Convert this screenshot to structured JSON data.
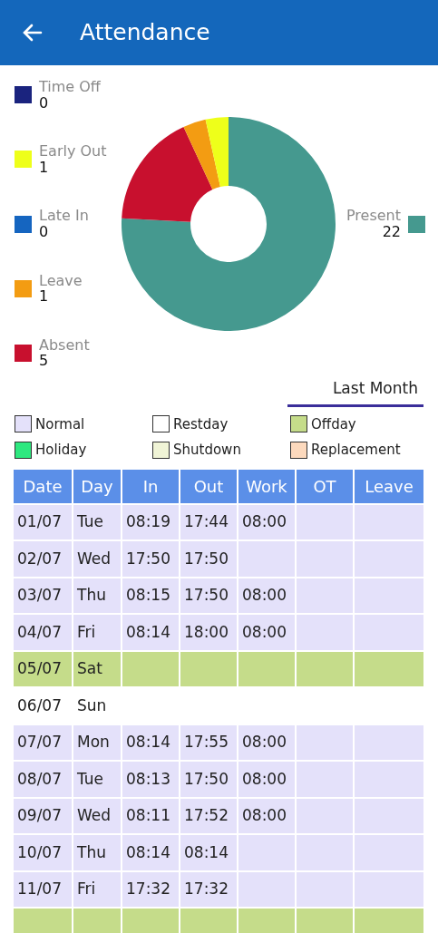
{
  "header": {
    "title": "Attendance"
  },
  "summary": {
    "left_legend": [
      {
        "label": "Time Off",
        "value": "0",
        "color": "#1a237e"
      },
      {
        "label": "Early Out",
        "value": "1",
        "color": "#eeff1a"
      },
      {
        "label": "Late In",
        "value": "0",
        "color": "#1565c0"
      },
      {
        "label": "Leave",
        "value": "1",
        "color": "#f39c12"
      },
      {
        "label": "Absent",
        "value": "5",
        "color": "#c8102e"
      }
    ],
    "right_legend": [
      {
        "label": "Present",
        "value": "22",
        "color": "#45998f"
      }
    ],
    "chart_data": {
      "type": "donut",
      "values": [
        0,
        3.45,
        0,
        3.45,
        17.24,
        75.86
      ]
    }
  },
  "period_tab": {
    "label": "Last Month",
    "selected": true
  },
  "day_types": [
    {
      "kind": "normal",
      "label": "Normal",
      "color": "#e4e1fa"
    },
    {
      "kind": "restday",
      "label": "Restday",
      "color": "#ffffff"
    },
    {
      "kind": "offday",
      "label": "Offday",
      "color": "#c5dc8a"
    },
    {
      "kind": "holiday",
      "label": "Holiday",
      "color": "#2ee87f"
    },
    {
      "kind": "shutdown",
      "label": "Shutdown",
      "color": "#f0f4d6"
    },
    {
      "kind": "replacement",
      "label": "Replacement",
      "color": "#fcd9bd"
    }
  ],
  "table": {
    "columns": [
      "Date",
      "Day",
      "In",
      "Out",
      "Work",
      "OT",
      "Leave"
    ],
    "rows": [
      {
        "kind": "normal",
        "cells": [
          "01/07",
          "Tue",
          "08:19",
          "17:44",
          "08:00",
          "",
          ""
        ]
      },
      {
        "kind": "normal",
        "cells": [
          "02/07",
          "Wed",
          "17:50",
          "17:50",
          "",
          "",
          ""
        ]
      },
      {
        "kind": "normal",
        "cells": [
          "03/07",
          "Thu",
          "08:15",
          "17:50",
          "08:00",
          "",
          ""
        ]
      },
      {
        "kind": "normal",
        "cells": [
          "04/07",
          "Fri",
          "08:14",
          "18:00",
          "08:00",
          "",
          ""
        ]
      },
      {
        "kind": "offday",
        "cells": [
          "05/07",
          "Sat",
          "",
          "",
          "",
          "",
          ""
        ]
      },
      {
        "kind": "restday",
        "cells": [
          "06/07",
          "Sun",
          "",
          "",
          "",
          "",
          ""
        ]
      },
      {
        "kind": "normal",
        "cells": [
          "07/07",
          "Mon",
          "08:14",
          "17:55",
          "08:00",
          "",
          ""
        ]
      },
      {
        "kind": "normal",
        "cells": [
          "08/07",
          "Tue",
          "08:13",
          "17:50",
          "08:00",
          "",
          ""
        ]
      },
      {
        "kind": "normal",
        "cells": [
          "09/07",
          "Wed",
          "08:11",
          "17:52",
          "08:00",
          "",
          ""
        ]
      },
      {
        "kind": "normal",
        "cells": [
          "10/07",
          "Thu",
          "08:14",
          "08:14",
          "",
          "",
          ""
        ]
      },
      {
        "kind": "normal",
        "cells": [
          "11/07",
          "Fri",
          "17:32",
          "17:32",
          "",
          "",
          ""
        ]
      },
      {
        "kind": "offday",
        "cells": [
          "",
          "",
          "",
          "",
          "",
          "",
          ""
        ]
      }
    ]
  }
}
